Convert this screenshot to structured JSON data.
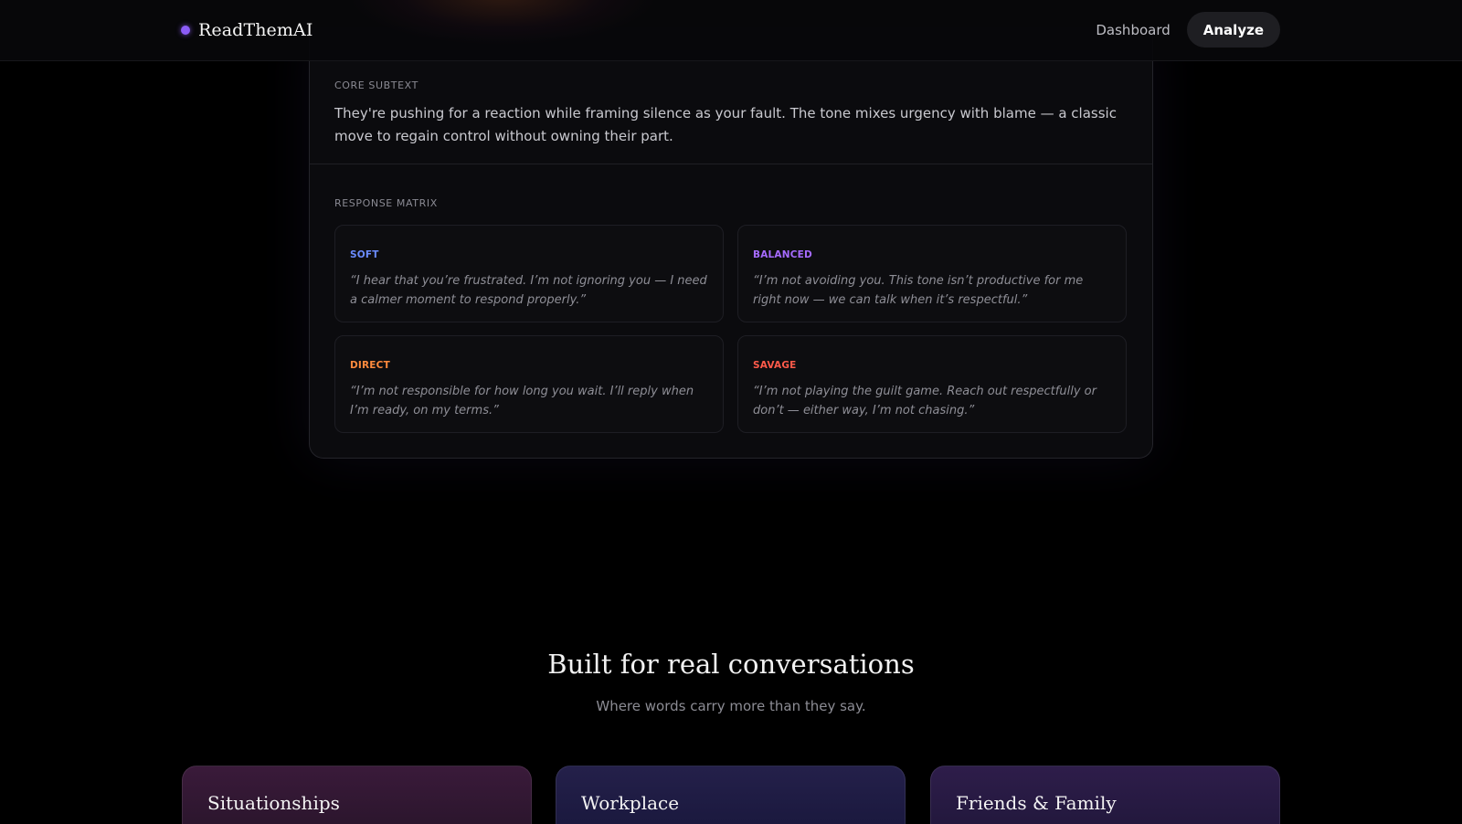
{
  "brand": {
    "name": "ReadThemAI",
    "accent": "#8b5cf6"
  },
  "nav": {
    "dashboard_label": "Dashboard",
    "analyze_label": "Analyze"
  },
  "analysis": {
    "subtext_label": "CORE SUBTEXT",
    "subtext_body": "They're pushing for a reaction while framing silence as your fault. The tone mixes urgency with blame — a classic move to regain control without owning their part.",
    "matrix_label": "RESPONSE MATRIX",
    "responses": [
      {
        "tag": "SOFT",
        "color": "#6b8cff",
        "text": "“I hear that you’re frustrated. I’m not ignoring you — I need a calmer moment to respond properly.”"
      },
      {
        "tag": "BALANCED",
        "color": "#a66bff",
        "text": "“I’m not avoiding you. This tone isn’t productive for me right now — we can talk when it’s respectful.”"
      },
      {
        "tag": "DIRECT",
        "color": "#ff8a3d",
        "text": "“I’m not responsible for how long you wait. I’ll reply when I’m ready, on my terms.”"
      },
      {
        "tag": "SAVAGE",
        "color": "#ff5a4a",
        "text": "“I’m not playing the guilt game. Reach out respectfully or don’t — either way, I’m not chasing.”"
      }
    ]
  },
  "built": {
    "title": "Built for real conversations",
    "subtitle": "Where words carry more than they say.",
    "categories": [
      "Situationships",
      "Workplace",
      "Friends & Family"
    ]
  }
}
